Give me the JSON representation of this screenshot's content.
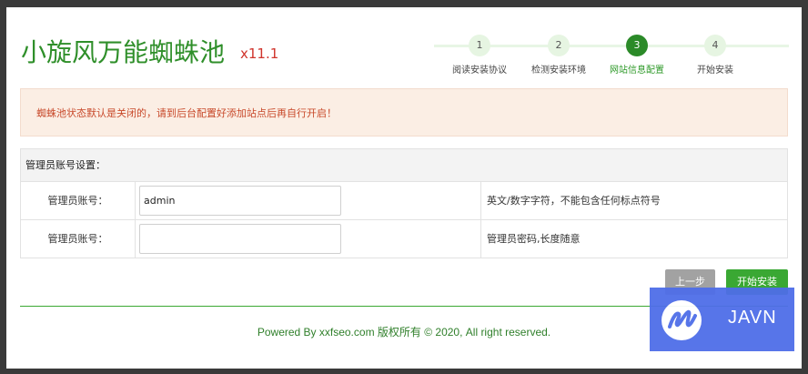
{
  "header": {
    "logo": "小旋风万能蜘蛛池",
    "version": "x11.1"
  },
  "steps": [
    {
      "num": "1",
      "label": "阅读安装协议",
      "active": false
    },
    {
      "num": "2",
      "label": "检测安装环境",
      "active": false
    },
    {
      "num": "3",
      "label": "网站信息配置",
      "active": true
    },
    {
      "num": "4",
      "label": "开始安装",
      "active": false
    }
  ],
  "notice": "蜘蛛池状态默认是关闭的，请到后台配置好添加站点后再自行开启！",
  "form": {
    "section_title": "管理员账号设置：",
    "rows": [
      {
        "label": "管理员账号：",
        "value": "admin",
        "hint": "英文/数字字符，不能包含任何标点符号"
      },
      {
        "label": "管理员账号：",
        "value": "",
        "hint": "管理员密码,长度随意"
      }
    ]
  },
  "buttons": {
    "prev": "上一步",
    "start": "开始安装"
  },
  "footer": "Powered By xxfseo.com 版权所有 © 2020, All right reserved.",
  "watermark": {
    "text": "JAVN",
    "icon": "javn-logo-icon"
  },
  "colors": {
    "brand_green": "#2f8f2a",
    "button_green": "#3aa833",
    "notice_text": "#c8492a",
    "notice_bg": "#fbeee4",
    "version_red": "#d0342c",
    "watermark_blue": "#4f6ee8"
  }
}
